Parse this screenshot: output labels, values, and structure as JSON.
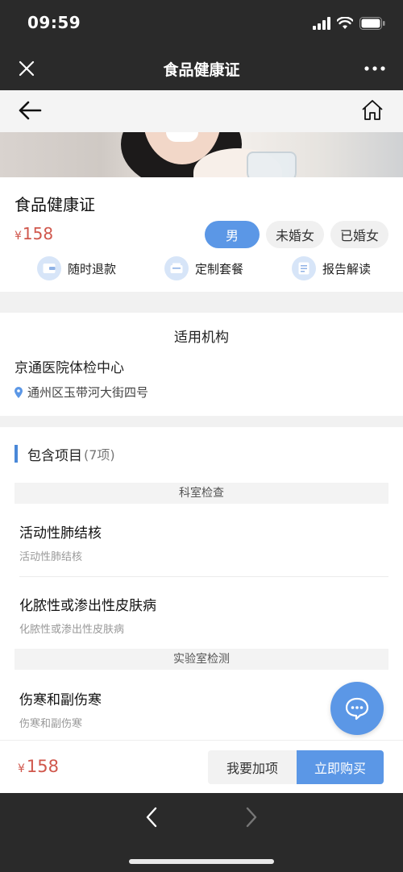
{
  "status_bar": {
    "time": "09:59"
  },
  "wx_nav": {
    "title": "食品健康证",
    "close_icon": "close-icon",
    "more_icon": "more-dots-icon"
  },
  "page_bar": {
    "back_icon": "arrow-left-icon",
    "home_icon": "home-icon"
  },
  "product": {
    "title": "食品健康证",
    "price_currency": "¥",
    "price": "158",
    "options": [
      {
        "label": "男",
        "selected": true
      },
      {
        "label": "未婚女",
        "selected": false
      },
      {
        "label": "已婚女",
        "selected": false
      }
    ],
    "features": [
      {
        "label": "随时退款",
        "icon": "refund-icon"
      },
      {
        "label": "定制套餐",
        "icon": "package-icon"
      },
      {
        "label": "报告解读",
        "icon": "report-icon"
      }
    ]
  },
  "institution": {
    "heading": "适用机构",
    "name": "京通医院体检中心",
    "address": "通州区玉带河大街四号"
  },
  "items": {
    "title": "包含项目",
    "count": "(7项)",
    "categories": [
      "科室检查",
      "实验室检测"
    ],
    "list": [
      {
        "name": "活动性肺结核",
        "sub": "活动性肺结核"
      },
      {
        "name": "化脓性或渗出性皮肤病",
        "sub": "化脓性或渗出性皮肤病"
      },
      {
        "name": "伤寒和副伤寒",
        "sub": "伤寒和副伤寒"
      }
    ]
  },
  "buy_bar": {
    "price_currency": "¥",
    "price": "158",
    "add_label": "我要加项",
    "buy_label": "立即购买"
  },
  "colors": {
    "accent": "#5b97e6",
    "price": "#d0574c",
    "dark_bar": "#2a2a2a"
  }
}
